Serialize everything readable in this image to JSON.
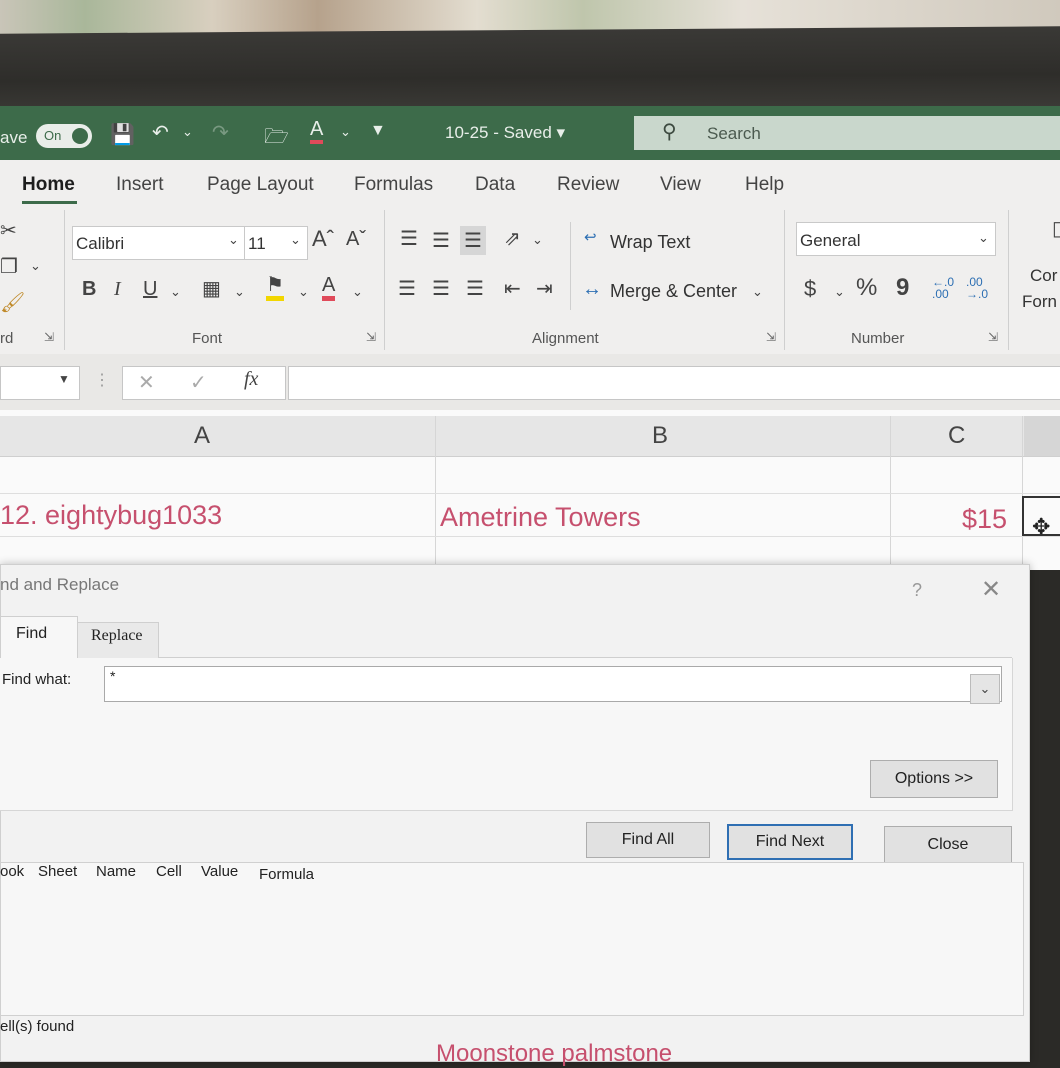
{
  "titlebar": {
    "autosave_label": "ave",
    "autosave_state": "On",
    "doc_title": "10-25  -  Saved  ▾",
    "search_placeholder": "Search"
  },
  "ribbon": {
    "tabs": [
      "Home",
      "Insert",
      "Page Layout",
      "Formulas",
      "Data",
      "Review",
      "View",
      "Help"
    ],
    "font": {
      "name": "Calibri",
      "size": "11",
      "bold": "B",
      "italic": "I",
      "underline": "U",
      "grow": "Aˆ",
      "shrink": "Aˇ"
    },
    "alignment": {
      "wrap_text": "Wrap Text",
      "merge_center": "Merge & Center"
    },
    "number": {
      "format": "General",
      "currency": "$",
      "percent": "%",
      "comma": "9",
      "inc_decimal": "←.0\n.00",
      "dec_decimal": ".00\n→.0"
    },
    "groups": {
      "clipboard": "rd",
      "font": "Font",
      "alignment": "Alignment",
      "number": "Number"
    },
    "styles_partial": {
      "line1": "Cor",
      "line2": "Forn"
    }
  },
  "formula_bar": {
    "fx": "fx"
  },
  "grid": {
    "columns": [
      "A",
      "B",
      "C"
    ],
    "row": {
      "a": "12. eightybug1033",
      "b": "Ametrine Towers",
      "c": "$15"
    }
  },
  "dialog": {
    "title": "nd and Replace",
    "help": "?",
    "close": "✕",
    "tabs": {
      "find": "Find",
      "replace": "Replace"
    },
    "find_what_label": "Find what:",
    "find_what_value": "*",
    "buttons": {
      "options": "Options >>",
      "find_all": "Find All",
      "find_next": "Find Next",
      "close": "Close"
    },
    "result_columns": [
      "ook",
      "Sheet",
      "Name",
      "Cell",
      "Value",
      "Formula"
    ],
    "status": "ell(s) found"
  },
  "bottom_partial_text": "Moonstone palmstone",
  "colors": {
    "titlebar": "#3d6b4a",
    "accent_pink": "#c6506e",
    "find_next_border": "#2f6fb3"
  }
}
